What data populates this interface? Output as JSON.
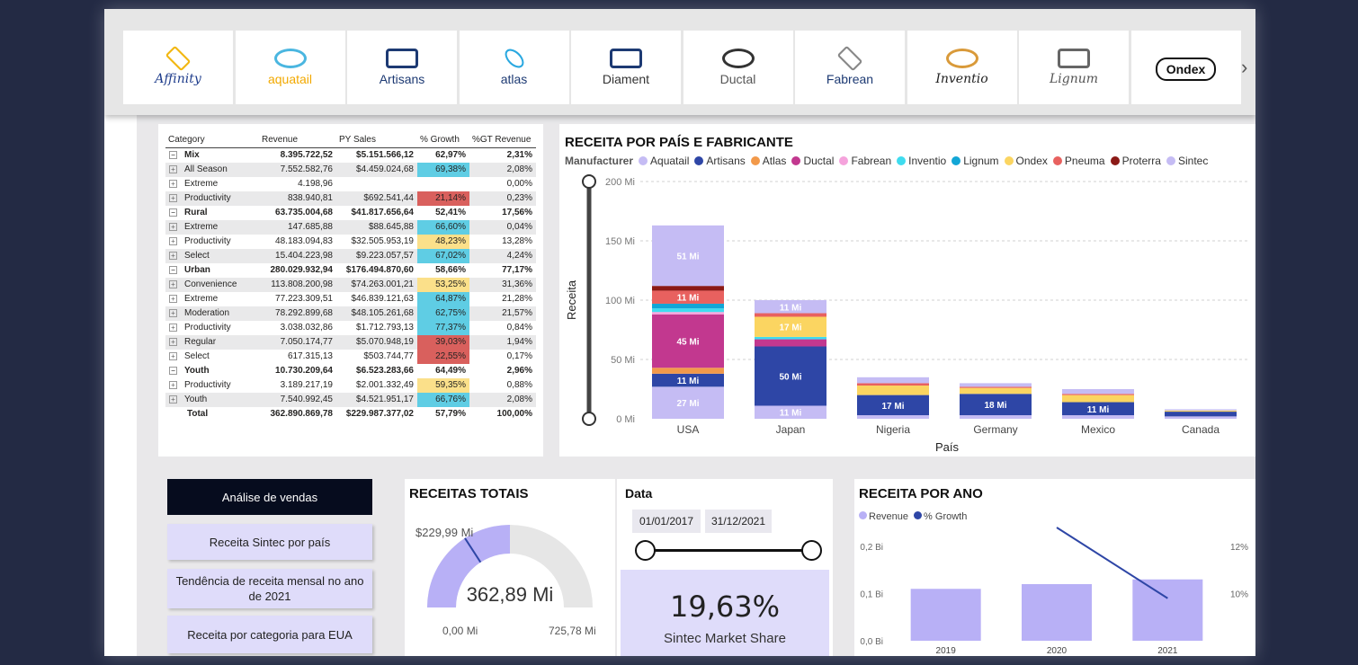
{
  "logos": [
    {
      "name": "Affinity",
      "text": "Affinity",
      "color": "#1f3d8c",
      "accent": "#f2b711"
    },
    {
      "name": "aquatail",
      "text": "aquatail",
      "color": "#f2a900",
      "accent": "#4ab6e0"
    },
    {
      "name": "Artisans",
      "text": "Artisans",
      "color": "#1d3a73",
      "accent": "#1d3a73"
    },
    {
      "name": "atlas",
      "text": "atlas",
      "color": "#1d3a73",
      "accent": "#2aa8e0"
    },
    {
      "name": "Diament",
      "text": "Diament",
      "color": "#333333",
      "accent": "#1d3a73"
    },
    {
      "name": "Ductal",
      "text": "Ductal",
      "color": "#555555",
      "accent": "#333333"
    },
    {
      "name": "Fabrean",
      "text": "Fabrean",
      "color": "#1d3a73",
      "accent": "#888888"
    },
    {
      "name": "Inventio",
      "text": "Inventio",
      "color": "#222222",
      "accent": "#d99a3a"
    },
    {
      "name": "Lignum",
      "text": "Lignum",
      "color": "#555555",
      "accent": "#666666"
    },
    {
      "name": "Ondex",
      "text": "Ondex",
      "color": "#111111",
      "accent": "#111111"
    }
  ],
  "logo_next": "›",
  "matrix": {
    "headers": [
      "Category",
      "Revenue",
      "PY Sales",
      "% Growth",
      "%GT Revenue"
    ],
    "rows": [
      {
        "label": "Mix",
        "rev": "8.395.722,52",
        "py": "$5.151.566,12",
        "growth": "62,97%",
        "gt": "2,31%",
        "level": 0,
        "gcolor": ""
      },
      {
        "label": "All Season",
        "rev": "7.552.582,76",
        "py": "$4.459.024,68",
        "growth": "69,38%",
        "gt": "2,08%",
        "level": 1,
        "gcolor": "#5fcde4"
      },
      {
        "label": "Extreme",
        "rev": "4.198,96",
        "py": "",
        "growth": "",
        "gt": "0,00%",
        "level": 1,
        "gcolor": ""
      },
      {
        "label": "Productivity",
        "rev": "838.940,81",
        "py": "$692.541,44",
        "growth": "21,14%",
        "gt": "0,23%",
        "level": 1,
        "gcolor": "#d9605d"
      },
      {
        "label": "Rural",
        "rev": "63.735.004,68",
        "py": "$41.817.656,64",
        "growth": "52,41%",
        "gt": "17,56%",
        "level": 0,
        "gcolor": ""
      },
      {
        "label": "Extreme",
        "rev": "147.685,88",
        "py": "$88.645,88",
        "growth": "66,60%",
        "gt": "0,04%",
        "level": 1,
        "gcolor": "#5fcde4"
      },
      {
        "label": "Productivity",
        "rev": "48.183.094,83",
        "py": "$32.505.953,19",
        "growth": "48,23%",
        "gt": "13,28%",
        "level": 1,
        "gcolor": "#fbe08a"
      },
      {
        "label": "Select",
        "rev": "15.404.223,98",
        "py": "$9.223.057,57",
        "growth": "67,02%",
        "gt": "4,24%",
        "level": 1,
        "gcolor": "#5fcde4"
      },
      {
        "label": "Urban",
        "rev": "280.029.932,94",
        "py": "$176.494.870,60",
        "growth": "58,66%",
        "gt": "77,17%",
        "level": 0,
        "gcolor": ""
      },
      {
        "label": "Convenience",
        "rev": "113.808.200,98",
        "py": "$74.263.001,21",
        "growth": "53,25%",
        "gt": "31,36%",
        "level": 1,
        "gcolor": "#fbe08a"
      },
      {
        "label": "Extreme",
        "rev": "77.223.309,51",
        "py": "$46.839.121,63",
        "growth": "64,87%",
        "gt": "21,28%",
        "level": 1,
        "gcolor": "#5fcde4"
      },
      {
        "label": "Moderation",
        "rev": "78.292.899,68",
        "py": "$48.105.261,68",
        "growth": "62,75%",
        "gt": "21,57%",
        "level": 1,
        "gcolor": "#5fcde4"
      },
      {
        "label": "Productivity",
        "rev": "3.038.032,86",
        "py": "$1.712.793,13",
        "growth": "77,37%",
        "gt": "0,84%",
        "level": 1,
        "gcolor": "#5fcde4"
      },
      {
        "label": "Regular",
        "rev": "7.050.174,77",
        "py": "$5.070.948,19",
        "growth": "39,03%",
        "gt": "1,94%",
        "level": 1,
        "gcolor": "#d9605d"
      },
      {
        "label": "Select",
        "rev": "617.315,13",
        "py": "$503.744,77",
        "growth": "22,55%",
        "gt": "0,17%",
        "level": 1,
        "gcolor": "#d9605d"
      },
      {
        "label": "Youth",
        "rev": "10.730.209,64",
        "py": "$6.523.283,66",
        "growth": "64,49%",
        "gt": "2,96%",
        "level": 0,
        "gcolor": ""
      },
      {
        "label": "Productivity",
        "rev": "3.189.217,19",
        "py": "$2.001.332,49",
        "growth": "59,35%",
        "gt": "0,88%",
        "level": 1,
        "gcolor": "#fbe08a"
      },
      {
        "label": "Youth",
        "rev": "7.540.992,45",
        "py": "$4.521.951,17",
        "growth": "66,76%",
        "gt": "2,08%",
        "level": 1,
        "gcolor": "#5fcde4"
      },
      {
        "label": "Total",
        "rev": "362.890.869,78",
        "py": "$229.987.377,02",
        "growth": "57,79%",
        "gt": "100,00%",
        "level": -1,
        "gcolor": ""
      }
    ]
  },
  "bar_chart_title": "RECEITA POR PAÍS E FABRICANTE",
  "legend_title": "Manufacturer",
  "legend": [
    {
      "name": "Aquatail",
      "color": "#c5bcf4"
    },
    {
      "name": "Artisans",
      "color": "#2e46a6"
    },
    {
      "name": "Atlas",
      "color": "#f2994a"
    },
    {
      "name": "Ductal",
      "color": "#c2388f"
    },
    {
      "name": "Fabrean",
      "color": "#f5a3dc"
    },
    {
      "name": "Inventio",
      "color": "#3fdcef"
    },
    {
      "name": "Lignum",
      "color": "#12a6d6"
    },
    {
      "name": "Ondex",
      "color": "#fbd561"
    },
    {
      "name": "Pneuma",
      "color": "#e8615f"
    },
    {
      "name": "Proterra",
      "color": "#8b1a16"
    },
    {
      "name": "Sintec",
      "color": "#c5bcf4"
    }
  ],
  "chart_data": [
    {
      "type": "bar",
      "title": "RECEITA POR PAÍS E FABRICANTE",
      "xlabel": "País",
      "ylabel": "Receita",
      "ylim": [
        0,
        200
      ],
      "yticks": [
        "0 Mi",
        "50 Mi",
        "100 Mi",
        "150 Mi",
        "200 Mi"
      ],
      "categories": [
        "USA",
        "Japan",
        "Nigeria",
        "Germany",
        "Mexico",
        "Canada"
      ],
      "stacked": true,
      "segments": [
        [
          {
            "m": "Aquatail",
            "v": 27,
            "label": "27 Mi"
          },
          {
            "m": "Artisans",
            "v": 11,
            "label": "11 Mi"
          },
          {
            "m": "Atlas",
            "v": 5,
            "label": ""
          },
          {
            "m": "Ductal",
            "v": 45,
            "label": "45 Mi"
          },
          {
            "m": "Fabrean",
            "v": 2,
            "label": ""
          },
          {
            "m": "Inventio",
            "v": 3,
            "label": ""
          },
          {
            "m": "Lignum",
            "v": 4,
            "label": ""
          },
          {
            "m": "Pneuma",
            "v": 11,
            "label": "11 Mi"
          },
          {
            "m": "Proterra",
            "v": 4,
            "label": ""
          },
          {
            "m": "Sintec",
            "v": 51,
            "label": "51 Mi"
          }
        ],
        [
          {
            "m": "Aquatail",
            "v": 11,
            "label": "11 Mi"
          },
          {
            "m": "Artisans",
            "v": 50,
            "label": "50 Mi"
          },
          {
            "m": "Ductal",
            "v": 6,
            "label": ""
          },
          {
            "m": "Inventio",
            "v": 2,
            "label": ""
          },
          {
            "m": "Ondex",
            "v": 17,
            "label": "17 Mi"
          },
          {
            "m": "Pneuma",
            "v": 3,
            "label": ""
          },
          {
            "m": "Sintec",
            "v": 11,
            "label": "11 Mi"
          }
        ],
        [
          {
            "m": "Aquatail",
            "v": 3,
            "label": ""
          },
          {
            "m": "Artisans",
            "v": 17,
            "label": "17 Mi"
          },
          {
            "m": "Ondex",
            "v": 8,
            "label": ""
          },
          {
            "m": "Pneuma",
            "v": 2,
            "label": ""
          },
          {
            "m": "Sintec",
            "v": 5,
            "label": ""
          }
        ],
        [
          {
            "m": "Aquatail",
            "v": 3,
            "label": ""
          },
          {
            "m": "Artisans",
            "v": 18,
            "label": "18 Mi"
          },
          {
            "m": "Ondex",
            "v": 5,
            "label": ""
          },
          {
            "m": "Pneuma",
            "v": 1,
            "label": ""
          },
          {
            "m": "Sintec",
            "v": 3,
            "label": ""
          }
        ],
        [
          {
            "m": "Aquatail",
            "v": 3,
            "label": ""
          },
          {
            "m": "Artisans",
            "v": 11,
            "label": "11 Mi"
          },
          {
            "m": "Ondex",
            "v": 6,
            "label": ""
          },
          {
            "m": "Pneuma",
            "v": 1,
            "label": ""
          },
          {
            "m": "Sintec",
            "v": 4,
            "label": ""
          }
        ],
        [
          {
            "m": "Aquatail",
            "v": 2,
            "label": ""
          },
          {
            "m": "Artisans",
            "v": 4,
            "label": ""
          },
          {
            "m": "Ondex",
            "v": 1,
            "label": ""
          },
          {
            "m": "Sintec",
            "v": 1,
            "label": ""
          }
        ]
      ]
    },
    {
      "type": "bar",
      "title": "RECEITA POR ANO",
      "categories": [
        "2019",
        "2020",
        "2021"
      ],
      "series": [
        {
          "name": "Revenue",
          "values": [
            0.11,
            0.12,
            0.13
          ],
          "color": "#b8b0f6"
        },
        {
          "name": "% Growth",
          "values": [
            null,
            12.8,
            9.8
          ],
          "color": "#2e46a6",
          "type": "line"
        }
      ],
      "ylim": [
        0,
        0.2
      ],
      "yticks": [
        "0,0 Bi",
        "0,1 Bi",
        "0,2 Bi"
      ],
      "y2ticks": [
        "10%",
        "12%"
      ],
      "y2lim": [
        8,
        12
      ]
    },
    {
      "type": "gauge",
      "value": 362.89,
      "min": 0,
      "max": 725.78,
      "target": 229.99
    }
  ],
  "nav": {
    "header": "Análise de vendas",
    "buttons": [
      "Receita Sintec por país",
      "Tendência de receita mensal no ano de 2021",
      "Receita por categoria para EUA"
    ]
  },
  "gauge": {
    "title": "RECEITAS TOTAIS",
    "value_label": "362,89 Mi",
    "min_label": "0,00 Mi",
    "max_label": "725,78 Mi",
    "target_label": "$229,99 Mi",
    "fill_color": "#b8b0f6",
    "track_color": "#e6e6e6",
    "target_color": "#2e46a6"
  },
  "date_slicer": {
    "title": "Data",
    "start": "01/01/2017",
    "end": "31/12/2021"
  },
  "kpi": {
    "value": "19,63%",
    "label": "Sintec Market Share"
  },
  "year_chart": {
    "title": "RECEITA POR ANO",
    "legend": [
      {
        "name": "Revenue",
        "color": "#b8b0f6"
      },
      {
        "name": "% Growth",
        "color": "#2e46a6"
      }
    ]
  }
}
